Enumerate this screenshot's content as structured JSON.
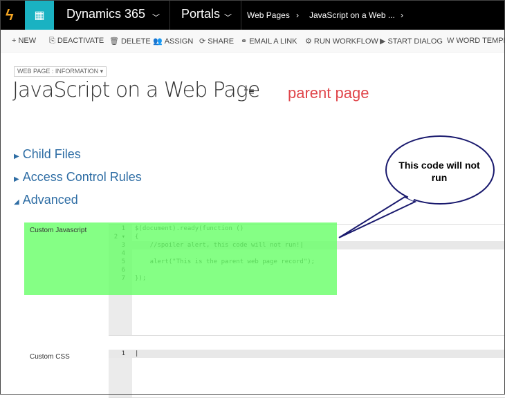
{
  "topbar": {
    "app_name": "Dynamics 365",
    "area": "Portals",
    "breadcrumb": [
      "Web Pages",
      "JavaScript on a Web ..."
    ],
    "accent": "#1ab2c2"
  },
  "toolbar": [
    {
      "icon": "plus-icon",
      "glyph": "+",
      "label": "NEW"
    },
    {
      "icon": "deactivate-icon",
      "glyph": "⎘",
      "label": "DEACTIVATE"
    },
    {
      "icon": "trash-icon",
      "glyph": "🗑",
      "label": "DELETE"
    },
    {
      "icon": "assign-icon",
      "glyph": "👥",
      "label": "ASSIGN"
    },
    {
      "icon": "share-icon",
      "glyph": "⟳",
      "label": "SHARE"
    },
    {
      "icon": "link-icon",
      "glyph": "⚭",
      "label": "EMAIL A LINK"
    },
    {
      "icon": "workflow-icon",
      "glyph": "⚙",
      "label": "RUN WORKFLOW"
    },
    {
      "icon": "dialog-icon",
      "glyph": "▶",
      "label": "START DIALOG"
    },
    {
      "icon": "word-icon",
      "glyph": "W",
      "label": "WORD TEMPLATES"
    }
  ],
  "form": {
    "selector": "WEB PAGE : INFORMATION ▾",
    "title": "JavaScript on a Web Page",
    "annotation": "parent page",
    "annotation_color": "#e0464b"
  },
  "sections": [
    "Child Files",
    "Access Control Rules",
    "Advanced"
  ],
  "callout": {
    "text": "This code will not run"
  },
  "custom_js": {
    "label": "Custom Javascript",
    "lines": [
      {
        "n": "1",
        "code": "$(document).ready(function ()"
      },
      {
        "n": "2 ▾",
        "code": "{"
      },
      {
        "n": "3",
        "code": "    //spoiler alert, this code will not run!|"
      },
      {
        "n": "4",
        "code": ""
      },
      {
        "n": "5",
        "code": "    alert(\"This is the parent web page record\");"
      },
      {
        "n": "6",
        "code": ""
      },
      {
        "n": "7",
        "code": "});"
      }
    ],
    "active_line": 3,
    "highlight_color": "#66ff66"
  },
  "custom_css": {
    "label": "Custom CSS",
    "lines": [
      {
        "n": "1",
        "code": "|"
      }
    ]
  }
}
